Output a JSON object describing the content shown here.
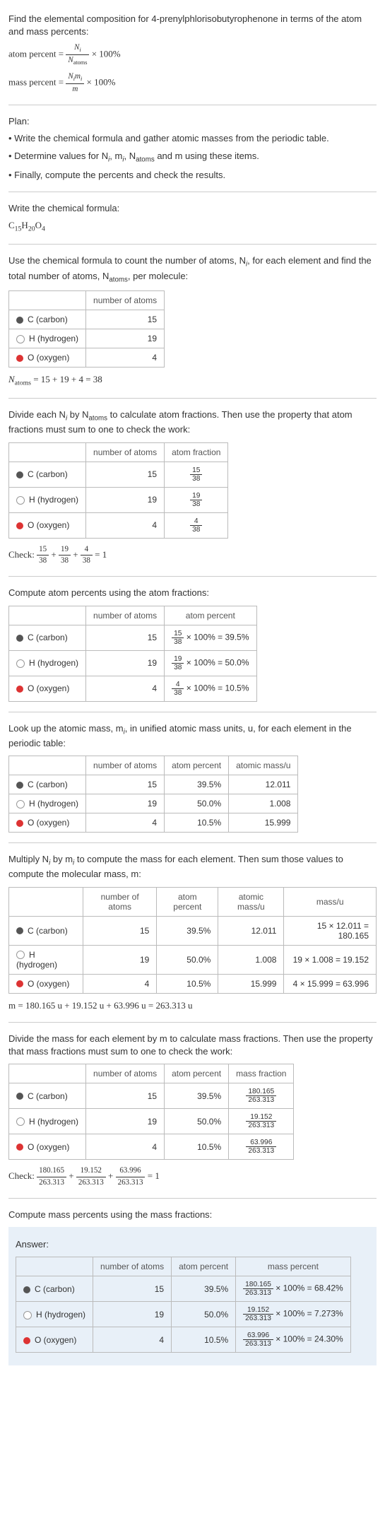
{
  "intro": {
    "line1": "Find the elemental composition for 4-prenylphlorisobutyrophenone in terms of the atom and mass percents:",
    "eq1_lhs": "atom percent = ",
    "eq1_n": "N",
    "eq1_i": "i",
    "eq1_d": "N",
    "eq1_da": "atoms",
    "eq1_tail": " × 100%",
    "eq2_lhs": "mass percent = ",
    "eq2_n": "N",
    "eq2_i": "i",
    "eq2_m": "m",
    "eq2_d": "m",
    "eq2_tail": " × 100%"
  },
  "plan": {
    "h": "Plan:",
    "b1": "• Write the chemical formula and gather atomic masses from the periodic table.",
    "b2": "• Determine values for N",
    "b2i": "i",
    "b2m": ", m",
    "b2n": ", N",
    "b2a": "atoms",
    "b2t": " and m using these items.",
    "b3": "• Finally, compute the percents and check the results."
  },
  "cf": {
    "h": "Write the chemical formula:",
    "f": "C",
    "f1": "15",
    "f2": "H",
    "f3": "20",
    "f4": "O",
    "f5": "4"
  },
  "count": {
    "h1": "Use the chemical formula to count the number of atoms, N",
    "hi": "i",
    "h2": ", for each element and find the total number of atoms, N",
    "ha": "atoms",
    "h3": ", per molecule:",
    "col1": "number of atoms",
    "r1e": "C (carbon)",
    "r1n": "15",
    "r2e": "H (hydrogen)",
    "r2n": "19",
    "r3e": "O (oxygen)",
    "r3n": "4",
    "sum": "N",
    "suma": "atoms",
    "sume": " = 15 + 19 + 4 = 38"
  },
  "afrac": {
    "h": "Divide each N",
    "hi": "i",
    "h2": " by N",
    "ha": "atoms",
    "h3": " to calculate atom fractions. Then use the property that atom fractions must sum to one to check the work:",
    "col1": "number of atoms",
    "col2": "atom fraction",
    "r1n": "15",
    "r1fn": "15",
    "r1fd": "38",
    "r2n": "19",
    "r2fn": "19",
    "r2fd": "38",
    "r3n": "4",
    "r3fn": "4",
    "r3fd": "38",
    "check": "Check: ",
    "c1n": "15",
    "c1d": "38",
    "c2n": "19",
    "c2d": "38",
    "c3n": "4",
    "c3d": "38",
    "ce": " = 1"
  },
  "apct": {
    "h": "Compute atom percents using the atom fractions:",
    "col1": "number of atoms",
    "col2": "atom percent",
    "r1n": "15",
    "r1fn": "15",
    "r1fd": "38",
    "r1t": " × 100% = 39.5%",
    "r2n": "19",
    "r2fn": "19",
    "r2fd": "38",
    "r2t": " × 100% = 50.0%",
    "r3n": "4",
    "r3fn": "4",
    "r3fd": "38",
    "r3t": " × 100% = 10.5%"
  },
  "amass": {
    "h1": "Look up the atomic mass, m",
    "hi": "i",
    "h2": ", in unified atomic mass units, u, for each element in the periodic table:",
    "col1": "number of atoms",
    "col2": "atom percent",
    "col3": "atomic mass/u",
    "r1n": "15",
    "r1p": "39.5%",
    "r1m": "12.011",
    "r2n": "19",
    "r2p": "50.0%",
    "r2m": "1.008",
    "r3n": "4",
    "r3p": "10.5%",
    "r3m": "15.999"
  },
  "mmass": {
    "h1": "Multiply N",
    "hi": "i",
    "h2": " by m",
    "h3": " to compute the mass for each element. Then sum those values to compute the molecular mass, m:",
    "col1": "number of atoms",
    "col2": "atom percent",
    "col3": "atomic mass/u",
    "col4": "mass/u",
    "r1n": "15",
    "r1p": "39.5%",
    "r1m": "12.011",
    "r1c": "15 × 12.011 = 180.165",
    "r2n": "19",
    "r2p": "50.0%",
    "r2m": "1.008",
    "r2c": "19 × 1.008 = 19.152",
    "r3n": "4",
    "r3p": "10.5%",
    "r3m": "15.999",
    "r3c": "4 × 15.999 = 63.996",
    "sum": "m = 180.165 u + 19.152 u + 63.996 u = 263.313 u"
  },
  "mfrac": {
    "h": "Divide the mass for each element by m to calculate mass fractions. Then use the property that mass fractions must sum to one to check the work:",
    "col1": "number of atoms",
    "col2": "atom percent",
    "col3": "mass fraction",
    "r1n": "15",
    "r1p": "39.5%",
    "r1fn": "180.165",
    "r1fd": "263.313",
    "r2n": "19",
    "r2p": "50.0%",
    "r2fn": "19.152",
    "r2fd": "263.313",
    "r3n": "4",
    "r3p": "10.5%",
    "r3fn": "63.996",
    "r3fd": "263.313",
    "check": "Check: ",
    "c1n": "180.165",
    "c1d": "263.313",
    "c2n": "19.152",
    "c2d": "263.313",
    "c3n": "63.996",
    "c3d": "263.313",
    "ce": " = 1"
  },
  "ans": {
    "h": "Compute mass percents using the mass fractions:",
    "label": "Answer:",
    "col1": "number of atoms",
    "col2": "atom percent",
    "col3": "mass percent",
    "r1n": "15",
    "r1p": "39.5%",
    "r1fn": "180.165",
    "r1fd": "263.313",
    "r1t": " × 100% = 68.42%",
    "r2n": "19",
    "r2p": "50.0%",
    "r2fn": "19.152",
    "r2fd": "263.313",
    "r2t": " × 100% = 7.273%",
    "r3n": "4",
    "r3p": "10.5%",
    "r3fn": "63.996",
    "r3fd": "263.313",
    "r3t": " × 100% = 24.30%"
  },
  "el": {
    "c": "C (carbon)",
    "h": "H (hydrogen)",
    "o": "O (oxygen)"
  },
  "plus": " + "
}
